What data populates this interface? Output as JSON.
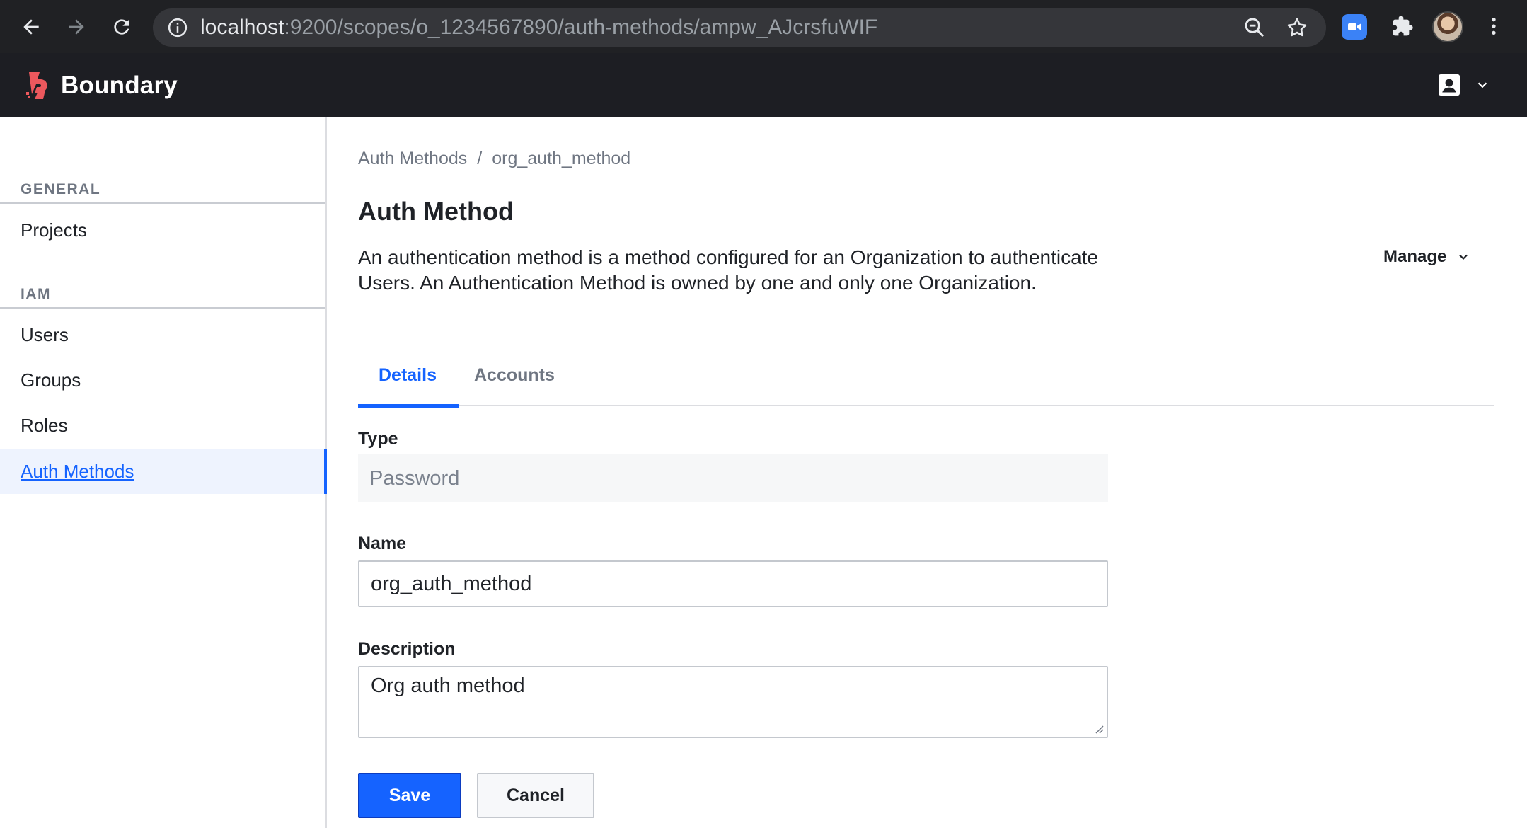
{
  "browser": {
    "url_host": "localhost",
    "url_path": ":9200/scopes/o_1234567890/auth-methods/ampw_AJcrsfuWIF",
    "icons": [
      "back-icon",
      "forward-icon",
      "reload-icon",
      "info-icon",
      "zoom-icon",
      "star-icon",
      "zoom-extension-icon",
      "puzzle-icon",
      "profile-avatar",
      "more-icon"
    ]
  },
  "header": {
    "brand": "Boundary",
    "logo_color": "#ec585d",
    "user_icon": "user-icon"
  },
  "sidebar": {
    "sections": [
      {
        "title": "GENERAL",
        "items": [
          {
            "label": "Projects",
            "active": false
          }
        ]
      },
      {
        "title": "IAM",
        "items": [
          {
            "label": "Users",
            "active": false
          },
          {
            "label": "Groups",
            "active": false
          },
          {
            "label": "Roles",
            "active": false
          },
          {
            "label": "Auth Methods",
            "active": true
          }
        ]
      }
    ]
  },
  "main": {
    "breadcrumb": [
      "Auth Methods",
      "org_auth_method"
    ],
    "breadcrumb_sep": "/",
    "title": "Auth Method",
    "description": "An authentication method is a method configured for an Organization to authenticate Users. An Authentication Method is owned by one and only one Organization.",
    "manage_label": "Manage",
    "tabs": [
      {
        "label": "Details",
        "active": true
      },
      {
        "label": "Accounts",
        "active": false
      }
    ],
    "form": {
      "type_label": "Type",
      "type_value": "Password",
      "name_label": "Name",
      "name_value": "org_auth_method",
      "description_label": "Description",
      "description_value": "Org auth method",
      "save_label": "Save",
      "cancel_label": "Cancel"
    }
  },
  "colors": {
    "accent": "#1563ff",
    "chrome_bg": "#202124",
    "header_bg": "#1d1e23"
  }
}
